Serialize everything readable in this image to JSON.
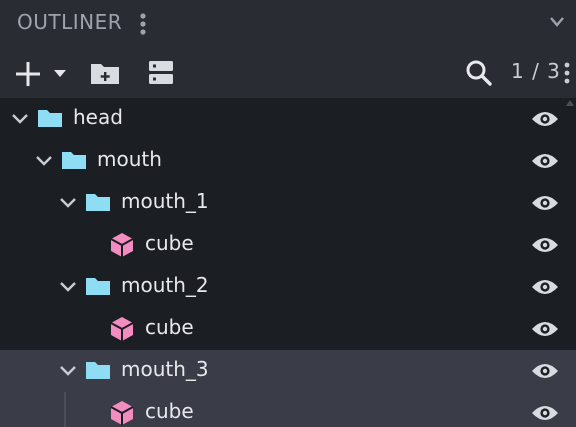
{
  "panel": {
    "title": "OUTLINER",
    "title_menu_icon": "vertical-dots-icon",
    "collapse_icon": "chevron-down-icon"
  },
  "toolbar": {
    "add_icon": "plus-icon",
    "add_dropdown_icon": "caret-down-icon",
    "new_folder_icon": "folder-add-icon",
    "group_icon": "stack-icon",
    "search_icon": "search-icon",
    "count": "1 / 3",
    "menu_icon": "vertical-dots-icon"
  },
  "tree": {
    "rows": [
      {
        "label": "head",
        "type": "folder",
        "expanded": true,
        "depth": 0,
        "selected": false,
        "visible": true
      },
      {
        "label": "mouth",
        "type": "folder",
        "expanded": true,
        "depth": 1,
        "selected": false,
        "visible": true
      },
      {
        "label": "mouth_1",
        "type": "folder",
        "expanded": true,
        "depth": 2,
        "selected": false,
        "visible": true
      },
      {
        "label": "cube",
        "type": "cube",
        "expanded": false,
        "depth": 3,
        "selected": false,
        "visible": true
      },
      {
        "label": "mouth_2",
        "type": "folder",
        "expanded": true,
        "depth": 2,
        "selected": false,
        "visible": true
      },
      {
        "label": "cube",
        "type": "cube",
        "expanded": false,
        "depth": 3,
        "selected": false,
        "visible": true
      },
      {
        "label": "mouth_3",
        "type": "folder",
        "expanded": true,
        "depth": 2,
        "selected": true,
        "visible": true
      },
      {
        "label": "cube",
        "type": "cube",
        "expanded": false,
        "depth": 3,
        "selected": true,
        "visible": true
      }
    ]
  },
  "colors": {
    "folder": "#8fdcf5",
    "cube": "#f38dc1",
    "selection": "#3a3d48",
    "panel_bg": "#292c33",
    "tree_bg": "#1b1e23"
  }
}
